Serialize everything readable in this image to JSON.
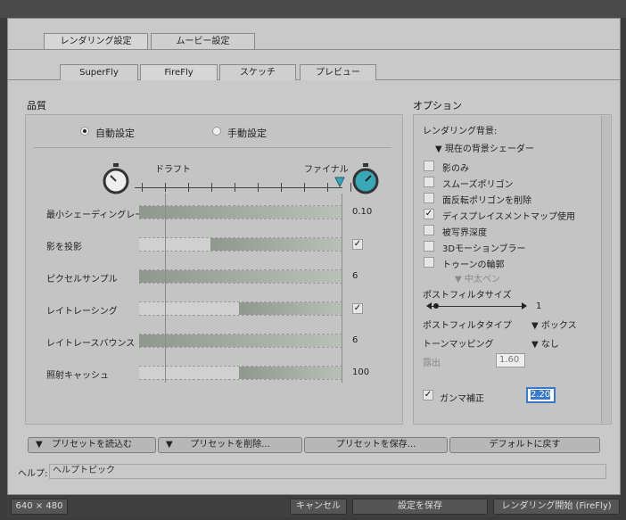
{
  "tabs_top": [
    {
      "label": "レンダリング設定"
    },
    {
      "label": "ムービー設定"
    }
  ],
  "tabs_engine": [
    {
      "label": "SuperFly"
    },
    {
      "label": "FireFly"
    },
    {
      "label": "スケッチ"
    },
    {
      "label": "プレビュー"
    }
  ],
  "quality": {
    "title": "品質",
    "auto_label": "自動設定",
    "manual_label": "手動設定",
    "draft_label": "ドラフト",
    "final_label": "ファイナル",
    "rows": [
      {
        "label": "最小シェーディングレート",
        "fill": 0.0,
        "value": "0.10",
        "check": false
      },
      {
        "label": "影を投影",
        "fill": 0.35,
        "value": "",
        "check": true
      },
      {
        "label": "ピクセルサンプル",
        "fill": 0.0,
        "value": "6",
        "check": false
      },
      {
        "label": "レイトレーシング",
        "fill": 0.49,
        "value": "",
        "check": true
      },
      {
        "label": "レイトレースバウンス",
        "fill": 0.0,
        "value": "6",
        "check": false
      },
      {
        "label": "照射キャッシュ",
        "fill": 0.49,
        "value": "100",
        "check": false
      }
    ]
  },
  "options": {
    "title": "オプション",
    "bg_label": "レンダリング背景:",
    "bg_value": "現在の背景シェーダー",
    "checks": [
      {
        "label": "影のみ",
        "checked": false
      },
      {
        "label": "スムーズポリゴン",
        "checked": false
      },
      {
        "label": "面反転ポリゴンを削除",
        "checked": false
      },
      {
        "label": "ディスプレイスメントマップ使用",
        "checked": true
      },
      {
        "label": "被写界深度",
        "checked": false
      },
      {
        "label": "3Dモーションブラー",
        "checked": false
      },
      {
        "label": "トゥーンの輪郭",
        "checked": false
      }
    ],
    "pen_label": "中太ペン",
    "postfilter_size_label": "ポストフィルタサイズ",
    "postfilter_size_value": "1",
    "postfilter_type_label": "ポストフィルタタイプ",
    "postfilter_type_value": "ボックス",
    "tonemap_label": "トーンマッピング",
    "tonemap_value": "なし",
    "exposure_label": "露出",
    "exposure_value": "1.60",
    "gamma_label": "ガンマ補正",
    "gamma_value": "2.20",
    "gamma_checked": true
  },
  "preset_buttons": [
    {
      "label": "プリセットを読込む"
    },
    {
      "label": "プリセットを削除..."
    },
    {
      "label": "プリセットを保存..."
    },
    {
      "label": "デフォルトに戻す"
    }
  ],
  "help": {
    "label": "ヘルプ:",
    "value": "ヘルプトピック"
  },
  "footer": {
    "size": "640 × 480",
    "cancel": "キャンセル",
    "save": "設定を保存",
    "render": "レンダリング開始 (FireFly)"
  },
  "colors": {
    "accent": "#3aa7b9",
    "highlight": "#3a78c8"
  }
}
